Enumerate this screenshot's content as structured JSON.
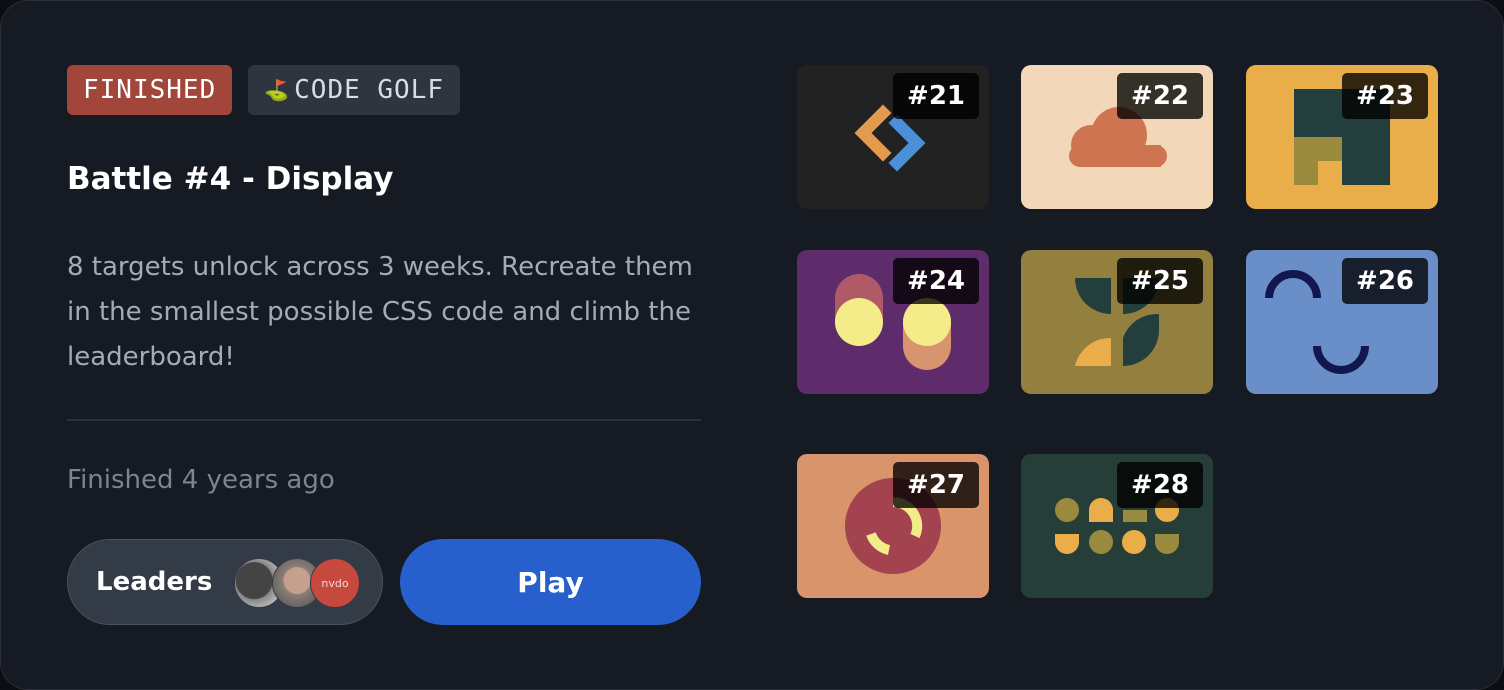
{
  "tags": {
    "status": "FINISHED",
    "category_icon": "golf-flag-icon",
    "category_emoji": "⛳",
    "category": "CODE GOLF"
  },
  "battle": {
    "title": "Battle #4 - Display",
    "description": "8 targets unlock across 3 weeks. Recreate them in the smallest possible CSS code and climb the leaderboard!",
    "status_text": "Finished 4 years ago"
  },
  "actions": {
    "leaders_label": "Leaders",
    "play_label": "Play"
  },
  "leaders": [
    {
      "name": "leader-avatar-1",
      "initials": ""
    },
    {
      "name": "leader-avatar-2",
      "initials": ""
    },
    {
      "name": "leader-avatar-3",
      "initials": "nvdo"
    }
  ],
  "targets": [
    {
      "number": "#21",
      "bg": "#222222"
    },
    {
      "number": "#22",
      "bg": "#f2d8b8"
    },
    {
      "number": "#23",
      "bg": "#e9ae4a"
    },
    {
      "number": "#24",
      "bg": "#5e2c6b"
    },
    {
      "number": "#25",
      "bg": "#937f3e"
    },
    {
      "number": "#26",
      "bg": "#6a8fc8"
    },
    {
      "number": "#27",
      "bg": "#d9946c"
    },
    {
      "number": "#28",
      "bg": "#253e38"
    }
  ]
}
